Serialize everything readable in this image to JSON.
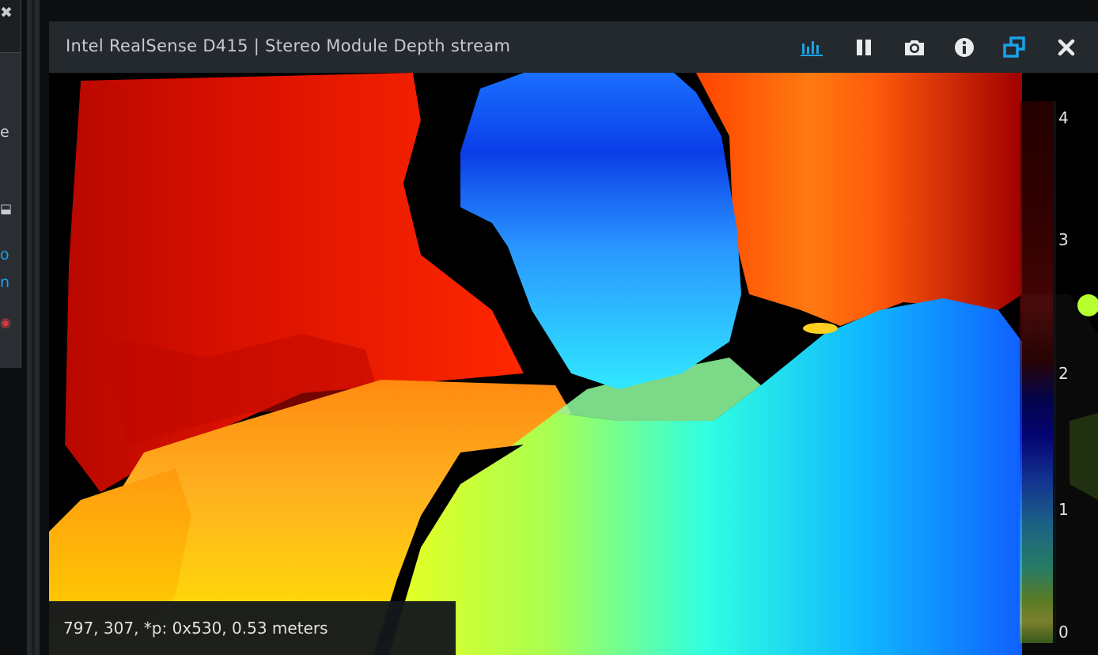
{
  "sidebar": {
    "glyphs": [
      "✖",
      "e",
      "⬓",
      "o",
      "n",
      "◉"
    ]
  },
  "stream": {
    "title": "Intel RealSense D415 | Stereo Module Depth stream",
    "toolbar": {
      "metrics_icon": "bar-chart-icon",
      "pause_icon": "pause-icon",
      "snapshot_icon": "camera-icon",
      "info_icon": "info-icon",
      "window_icon": "restore-window-icon",
      "close_icon": "close-icon"
    },
    "colors": {
      "active_icon": "#1aa3e8",
      "icon": "#e8ebee",
      "titlebar": "#24292e"
    },
    "colorbar": {
      "ticks": [
        "4",
        "3",
        "2",
        "1",
        "0"
      ],
      "unit": "meters"
    },
    "readout": "797, 307, *p: 0x530, 0.53 meters"
  }
}
